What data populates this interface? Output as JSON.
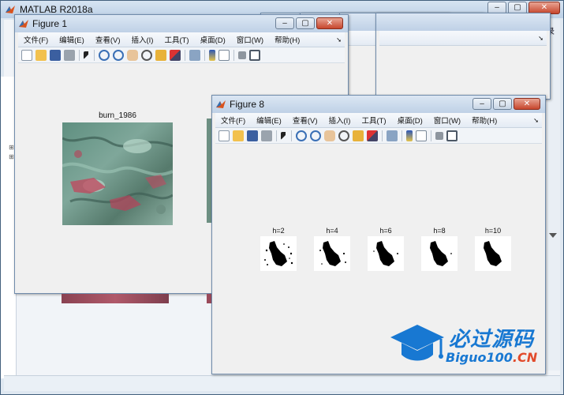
{
  "main_window": {
    "title": "MATLAB R2018a",
    "right_label": "录",
    "tree_marks": [
      "⊞",
      "⊞"
    ]
  },
  "menu_labels": [
    "文件(F)",
    "编辑(E)",
    "查看(V)",
    "插入(I)",
    "工具(T)",
    "桌面(D)",
    "窗口(W)",
    "帮助(H)"
  ],
  "figure1": {
    "title": "Figure 1",
    "image_title": "burn_1986"
  },
  "figure8": {
    "title": "Figure 8",
    "thumbnails": [
      {
        "label": "h=2"
      },
      {
        "label": "h=4"
      },
      {
        "label": "h=6"
      },
      {
        "label": "h=8"
      },
      {
        "label": "h=10"
      }
    ]
  },
  "icons": {
    "toolbar": [
      "new-file-icon",
      "open-folder-icon",
      "save-icon",
      "print-icon",
      "pointer-icon",
      "zoom-in-icon",
      "zoom-out-icon",
      "pan-hand-icon",
      "rotate-icon",
      "data-cursor-icon",
      "brush-icon",
      "link-icon",
      "colorbar-icon",
      "legend-icon",
      "hide-plot-tools-icon",
      "show-plot-tools-icon"
    ]
  },
  "watermark": {
    "cn_text": "必过源码",
    "en_text": "Biguo100",
    "en_suffix": ".CN"
  },
  "colors": {
    "accent": "#1878d2",
    "title_bar": "#c6d6ea"
  }
}
